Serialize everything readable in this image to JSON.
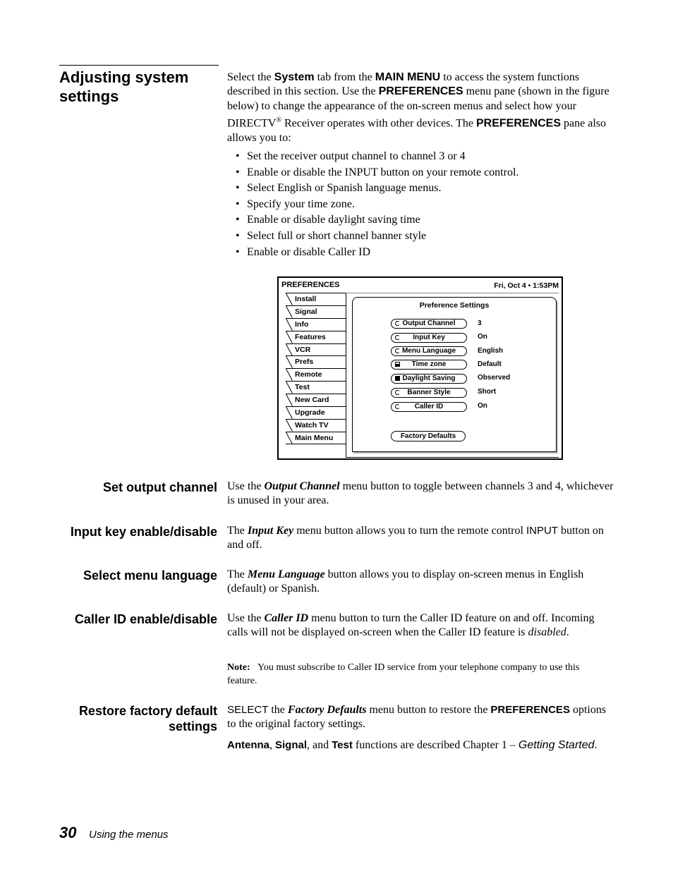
{
  "section": {
    "title": "Adjusting system settings",
    "intro": {
      "p1": "Select the ",
      "system": "System",
      "p2": " tab from the ",
      "main_menu": "MAIN MENU",
      "p3": " to access the system functions described in this section. Use the ",
      "preferences1": "PREFERENCES",
      "p4": " menu pane (shown in the figure below) to change the appearance of the on-screen menus and select how your DIRECTV",
      "reg": "®",
      "p5": " Receiver operates with other devices. The ",
      "preferences2": "PREFERENCES",
      "p6": " pane also allows you to:"
    },
    "bullets": [
      "Set the receiver output channel to channel 3 or 4",
      "Enable or disable the INPUT button on your remote control.",
      "Select English or Spanish language menus.",
      "Specify your time zone.",
      "Enable or disable daylight saving time",
      "Select full or short channel banner style",
      "Enable or disable Caller ID"
    ]
  },
  "figure": {
    "title": "PREFERENCES",
    "datetime": "Fri, Oct 4 • 1:53PM",
    "tabs": [
      "Install",
      "Signal",
      "Info",
      "Features",
      "VCR",
      "Prefs",
      "Remote",
      "Test",
      "New Card",
      "Upgrade",
      "Watch TV",
      "Main Menu"
    ],
    "active_tab": "Prefs",
    "pane_title": "Preference Settings",
    "settings": [
      {
        "label": "Output Channel",
        "value": "3",
        "icon": "cycle-icon"
      },
      {
        "label": "Input Key",
        "value": "On",
        "icon": "cycle-icon"
      },
      {
        "label": "Menu Language",
        "value": "English",
        "icon": "cycle-icon"
      },
      {
        "label": "Time zone",
        "value": "Default",
        "icon": "list-icon"
      },
      {
        "label": "Daylight Saving",
        "value": "Observed",
        "icon": "checkbox-icon"
      },
      {
        "label": "Banner Style",
        "value": "Short",
        "icon": "cycle-icon"
      },
      {
        "label": "Caller ID",
        "value": "On",
        "icon": "cycle-icon"
      }
    ],
    "factory_defaults": "Factory Defaults"
  },
  "subsections": {
    "output": {
      "heading": "Set output channel",
      "t1": "Use the ",
      "em": "Output Channel",
      "t2": " menu button to toggle between channels 3 and 4, whichever is unused in your area."
    },
    "input": {
      "heading": "Input key enable/disable",
      "t1": "The ",
      "em": "Input Key",
      "t2": " menu button allows you to turn the remote control ",
      "input": "INPUT",
      "t3": " button on and off."
    },
    "language": {
      "heading": "Select menu language",
      "t1": "The ",
      "em": "Menu Language",
      "t2": " button allows you to display on-screen menus in English (default) or Spanish."
    },
    "callerid": {
      "heading": "Caller ID enable/disable",
      "t1": "Use the ",
      "em": "Caller ID",
      "t2": " menu button to turn the Caller ID feature on and off. Incoming calls will not be displayed on-screen when the Caller ID feature is ",
      "disabled": "disabled",
      "t3": ".",
      "note_label": "Note:",
      "note_text": "You must subscribe to Caller ID service from your telephone company to use this feature."
    },
    "restore": {
      "heading1": "Restore factory default",
      "heading2": "settings",
      "select": "SELECT",
      "t1": " the ",
      "em": "Factory Defaults",
      "t2": " menu button to restore the ",
      "preferences": "PREFERENCES",
      "t3": " options to the original factory settings.",
      "antenna": "Antenna",
      "c1": ", ",
      "signal": "Signal",
      "c2": ", and ",
      "test": "Test",
      "t4": " functions are described Chapter 1 – ",
      "chapter": "Getting Started",
      "t5": "."
    }
  },
  "footer": {
    "page_number": "30",
    "chapter": "Using the menus"
  }
}
